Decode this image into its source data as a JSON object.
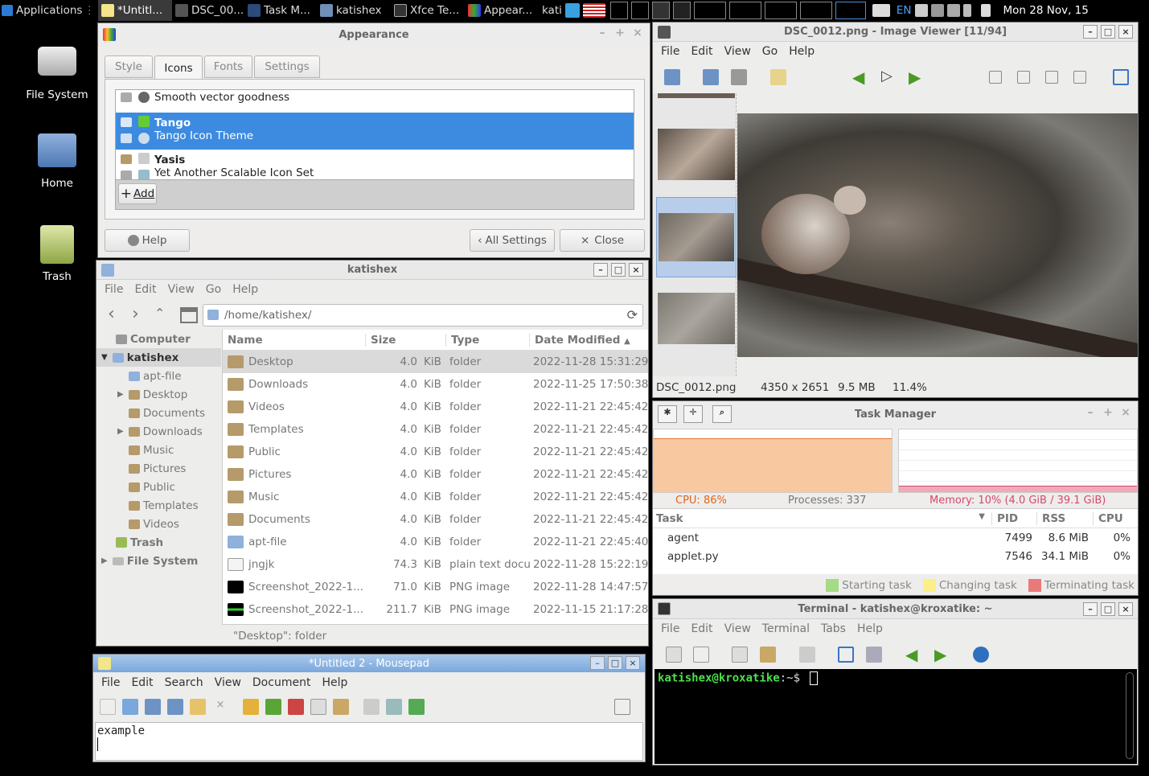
{
  "panel": {
    "apps_label": "Applications",
    "tasks": [
      "*Untitl...",
      "DSC_00...",
      "Task M...",
      "katishex",
      "Xfce Te...",
      "Appear..."
    ],
    "user": "kati",
    "lang": "EN",
    "clock": "Mon 28 Nov, 15"
  },
  "desktop": {
    "icons": [
      "File System",
      "Home",
      "Trash"
    ]
  },
  "appearance": {
    "title": "Appearance",
    "tabs": [
      "Style",
      "Icons",
      "Fonts",
      "Settings"
    ],
    "themes": [
      {
        "name": "Smooth vector goodness",
        "desc": ""
      },
      {
        "name": "Tango",
        "desc": "Tango Icon Theme"
      },
      {
        "name": "Yasis",
        "desc": "Yet Another Scalable Icon Set"
      }
    ],
    "add_label": "Add",
    "help_label": "Help",
    "all_settings_label": "All Settings",
    "close_label": "Close"
  },
  "fm": {
    "title": "katishex",
    "menu": [
      "File",
      "Edit",
      "View",
      "Go",
      "Help"
    ],
    "path": "/home/katishex/",
    "side_computer": "Computer",
    "side_home": "katishex",
    "side_items": [
      "apt-file",
      "Desktop",
      "Documents",
      "Downloads",
      "Music",
      "Pictures",
      "Public",
      "Templates",
      "Videos"
    ],
    "side_trash": "Trash",
    "side_fs": "File System",
    "columns": [
      "Name",
      "Size",
      "Type",
      "Date Modified"
    ],
    "rows": [
      [
        "Desktop",
        "4.0",
        "KiB",
        "folder",
        "2022-11-28 15:31:29"
      ],
      [
        "Downloads",
        "4.0",
        "KiB",
        "folder",
        "2022-11-25 17:50:38"
      ],
      [
        "Videos",
        "4.0",
        "KiB",
        "folder",
        "2022-11-21 22:45:42"
      ],
      [
        "Templates",
        "4.0",
        "KiB",
        "folder",
        "2022-11-21 22:45:42"
      ],
      [
        "Public",
        "4.0",
        "KiB",
        "folder",
        "2022-11-21 22:45:42"
      ],
      [
        "Pictures",
        "4.0",
        "KiB",
        "folder",
        "2022-11-21 22:45:42"
      ],
      [
        "Music",
        "4.0",
        "KiB",
        "folder",
        "2022-11-21 22:45:42"
      ],
      [
        "Documents",
        "4.0",
        "KiB",
        "folder",
        "2022-11-21 22:45:42"
      ],
      [
        "apt-file",
        "4.0",
        "KiB",
        "folder",
        "2022-11-21 22:45:40"
      ],
      [
        "jngjk",
        "74.3",
        "KiB",
        "plain text docu",
        "2022-11-28 15:22:19"
      ],
      [
        "Screenshot_2022-1...",
        "71.0",
        "KiB",
        "PNG image",
        "2022-11-28 14:47:57"
      ],
      [
        "Screenshot_2022-1...",
        "211.7",
        "KiB",
        "PNG image",
        "2022-11-15 21:17:28"
      ]
    ],
    "status": "\"Desktop\": folder"
  },
  "mousepad": {
    "title": "*Untitled 2 - Mousepad",
    "menu": [
      "File",
      "Edit",
      "Search",
      "View",
      "Document",
      "Help"
    ],
    "text": "example"
  },
  "viewer": {
    "title": "DSC_0012.png - Image Viewer [11/94]",
    "menu": [
      "File",
      "Edit",
      "View",
      "Go",
      "Help"
    ],
    "filename": "DSC_0012.png",
    "dims": "4350 x 2651",
    "size": "9.5  MB",
    "zoom": "11.4%"
  },
  "taskman": {
    "title": "Task Manager",
    "cpu": "CPU: 86%",
    "cpu_percent": 86,
    "processes": "Processes: 337",
    "memory": "Memory: 10% (4.0  GiB / 39.1  GiB)",
    "memory_percent": 10,
    "columns": [
      "Task",
      "PID",
      "RSS",
      "CPU"
    ],
    "rows": [
      [
        "agent",
        "7499",
        "8.6  MiB",
        "0%"
      ],
      [
        "applet.py",
        "7546",
        "34.1  MiB",
        "0%"
      ]
    ],
    "legend": [
      "Starting task",
      "Changing task",
      "Terminating task"
    ],
    "legend_colors": [
      "#a3dc85",
      "#fbf087",
      "#e97a7a"
    ]
  },
  "terminal": {
    "title": "Terminal - katishex@kroxatike: ~",
    "menu": [
      "File",
      "Edit",
      "View",
      "Terminal",
      "Tabs",
      "Help"
    ],
    "prompt_user": "katishex@kroxatike",
    "prompt_path": ":~$"
  }
}
